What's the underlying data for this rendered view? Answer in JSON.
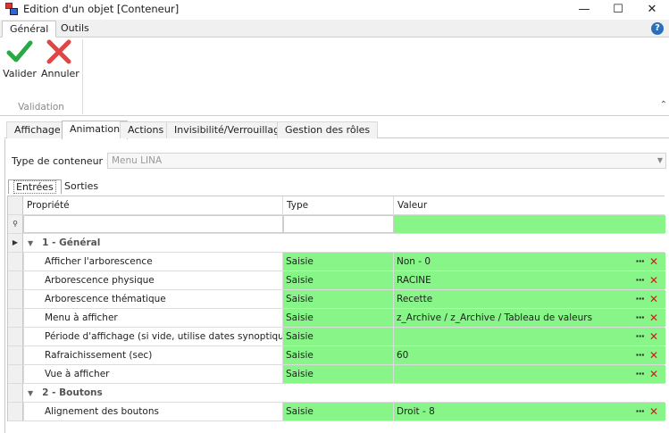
{
  "window": {
    "title": "Edition d'un objet [Conteneur]"
  },
  "ribbon": {
    "tabs": [
      "Général",
      "Outils"
    ],
    "buttons": {
      "validate": "Valider",
      "cancel": "Annuler"
    },
    "group_label": "Validation"
  },
  "page_tabs": [
    "Affichage",
    "Animation",
    "Actions",
    "Invisibilité/Verrouillage",
    "Gestion des rôles"
  ],
  "container_type": {
    "label": "Type de conteneur :",
    "value": "Menu LINA"
  },
  "sub_tabs": [
    "Entrées",
    "Sorties"
  ],
  "grid": {
    "headers": [
      "Propriété",
      "Type",
      "Valeur"
    ],
    "groups": [
      {
        "title": "1 - Général",
        "rows": [
          {
            "property": "Afficher l'arborescence",
            "type": "Saisie",
            "value": "Non - 0"
          },
          {
            "property": "Arborescence physique",
            "type": "Saisie",
            "value": "RACINE"
          },
          {
            "property": "Arborescence thématique",
            "type": "Saisie",
            "value": "Recette"
          },
          {
            "property": "Menu à afficher",
            "type": "Saisie",
            "value": "z_Archive / z_Archive / Tableau de valeurs"
          },
          {
            "property": "Période d'affichage (si vide, utilise dates synoptique)",
            "type": "Saisie",
            "value": ""
          },
          {
            "property": "Rafraichissement (sec)",
            "type": "Saisie",
            "value": "60"
          },
          {
            "property": "Vue à afficher",
            "type": "Saisie",
            "value": ""
          }
        ]
      },
      {
        "title": "2 - Boutons",
        "rows": [
          {
            "property": "Alignement des boutons",
            "type": "Saisie",
            "value": "Droit - 8"
          }
        ]
      }
    ],
    "action_labels": {
      "more": "···",
      "delete": "✕"
    }
  },
  "colors": {
    "value_bg": "#87f587",
    "delete": "#d41818",
    "check": "#2aa845",
    "cancel_x": "#e04646"
  },
  "icons": [
    "app-icon",
    "minimize-icon",
    "maximize-icon",
    "close-icon",
    "help-icon",
    "check-icon",
    "cancel-icon",
    "collapse-ribbon-icon",
    "filter-icon",
    "dropdown-arrow-icon"
  ]
}
